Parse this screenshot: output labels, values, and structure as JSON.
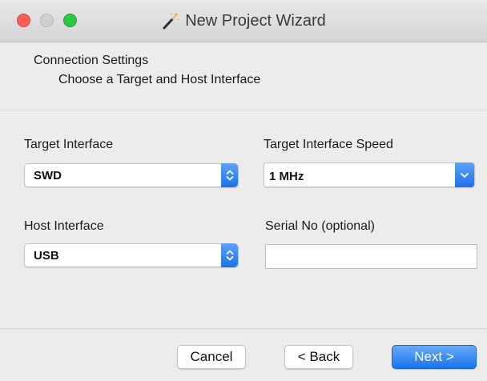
{
  "window": {
    "title": "New Project Wizard",
    "title_icon": "magic-wand-icon"
  },
  "header": {
    "title": "Connection Settings",
    "subtitle": "Choose a Target and Host Interface"
  },
  "form": {
    "target_interface": {
      "label": "Target Interface",
      "value": "SWD",
      "icon": "updown-chevron-icon"
    },
    "target_speed": {
      "label": "Target Interface Speed",
      "value": "1 MHz",
      "icon": "chevron-down-icon"
    },
    "host_interface": {
      "label": "Host Interface",
      "value": "USB",
      "icon": "updown-chevron-icon"
    },
    "serial_no": {
      "label": "Serial No (optional)",
      "value": ""
    }
  },
  "buttons": {
    "cancel": "Cancel",
    "back": "< Back",
    "next": "Next >"
  },
  "colors": {
    "accent": "#1a74ea",
    "close": "#fc5f57",
    "minimize_inactive": "#cfcfcf",
    "zoom": "#2bc840"
  }
}
